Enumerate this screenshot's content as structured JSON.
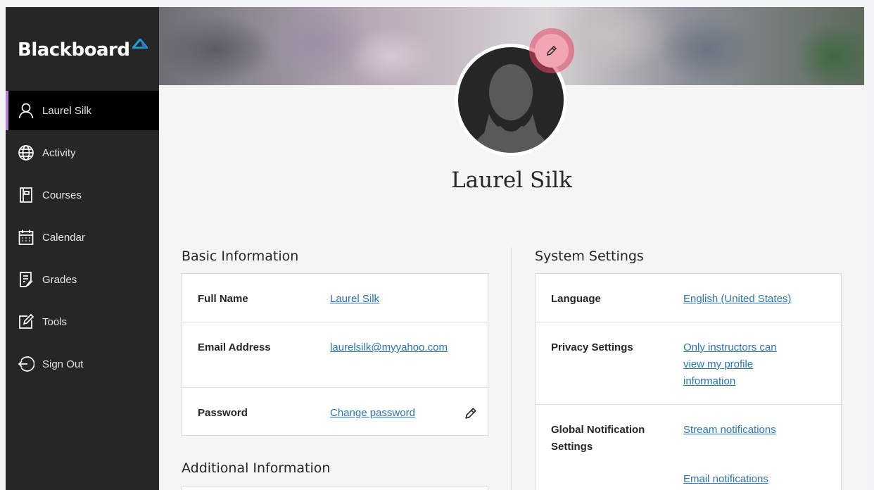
{
  "sidebar": {
    "logo": "Blackboard",
    "items": [
      {
        "label": "Laurel Silk",
        "icon": "user-icon",
        "active": true
      },
      {
        "label": "Activity",
        "icon": "globe-icon"
      },
      {
        "label": "Courses",
        "icon": "courses-icon"
      },
      {
        "label": "Calendar",
        "icon": "calendar-icon"
      },
      {
        "label": "Grades",
        "icon": "grades-icon"
      },
      {
        "label": "Tools",
        "icon": "tools-icon"
      },
      {
        "label": "Sign Out",
        "icon": "sign-out-icon"
      }
    ]
  },
  "profile": {
    "name": "Laurel Silk",
    "edit_avatar_icon": "pencil-icon"
  },
  "basic_information": {
    "title": "Basic Information",
    "rows": [
      {
        "label": "Full Name",
        "value": "Laurel Silk"
      },
      {
        "label": "Email Address",
        "value": "laurelsilk@myyahoo.com"
      },
      {
        "label": "Password",
        "value": "Change password",
        "icon": "pencil-icon"
      }
    ]
  },
  "additional_information": {
    "title": "Additional Information"
  },
  "system_settings": {
    "title": "System Settings",
    "rows": [
      {
        "label": "Language",
        "value": "English (United States)"
      },
      {
        "label": "Privacy Settings",
        "value": "Only instructors can view my profile information"
      },
      {
        "label": "Global Notification Settings",
        "value": "Stream notifications",
        "value2": "Email notifications"
      }
    ]
  },
  "colors": {
    "sidebar_bg": "#262626",
    "active_indicator": "#b77fd6",
    "link": "#2a74b5",
    "highlight": "#e64664"
  }
}
